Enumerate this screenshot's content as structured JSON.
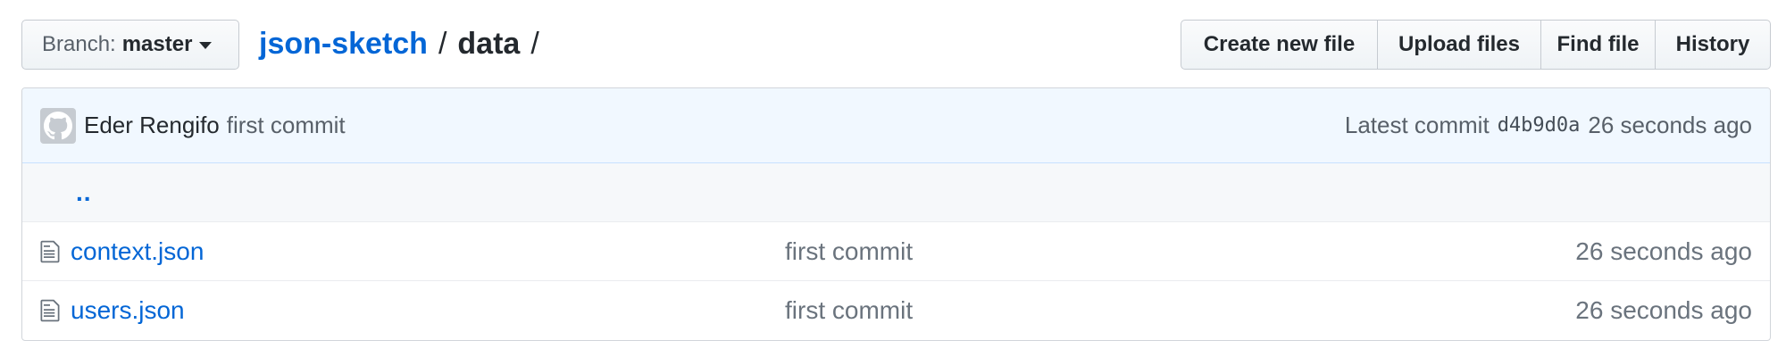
{
  "branch": {
    "label": "Branch:",
    "name": "master"
  },
  "breadcrumb": {
    "repo": "json-sketch",
    "separator": "/",
    "directory": "data",
    "trailing": "/"
  },
  "file_actions": {
    "create_new_file": "Create new file",
    "upload_files": "Upload files",
    "find_file": "Find file",
    "history": "History"
  },
  "latest_commit": {
    "author": "Eder Rengifo",
    "message": "first commit",
    "label": "Latest commit",
    "sha": "d4b9d0a",
    "age": "26 seconds ago"
  },
  "parent_dir_link": "..",
  "files": [
    {
      "name": "context.json",
      "message": "first commit",
      "age": "26 seconds ago",
      "icon": "file-icon"
    },
    {
      "name": "users.json",
      "message": "first commit",
      "age": "26 seconds ago",
      "icon": "file-icon"
    }
  ],
  "colors": {
    "link": "#0366d6",
    "commit_tease_bg": "#f1f8ff",
    "muted_text": "#586069"
  }
}
